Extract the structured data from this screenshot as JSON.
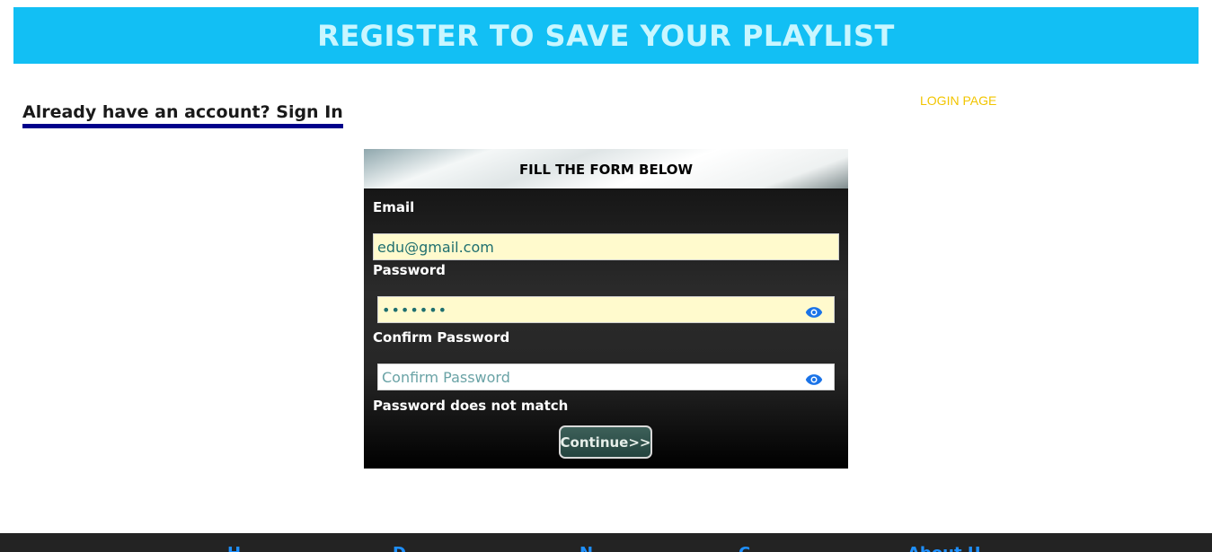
{
  "header": {
    "title": "REGISTER TO SAVE YOUR PLAYLIST"
  },
  "signin_prompt": "Already have an account? Sign In",
  "login_page_link": "LOGIN PAGE",
  "form": {
    "title": "FILL THE FORM BELOW",
    "email_label": "Email",
    "email_value": "edu@gmail.com",
    "password_label": "Password",
    "password_value": "•••••••",
    "confirm_label": "Confirm Password",
    "confirm_placeholder": "Confirm Password",
    "error_message": "Password does not match",
    "continue_label": "Continue>>"
  },
  "footer": {
    "nav_items": [
      "H",
      "D",
      "N",
      "C",
      "About U"
    ]
  },
  "icons": {
    "password_toggle": "eye-icon",
    "confirm_toggle": "eye-icon"
  },
  "colors": {
    "banner": "#12bff4",
    "banner_text": "#c9f6ff",
    "login_link": "#f2c500",
    "input_bg": "#fffacd",
    "eye_icon": "#1a73e8",
    "footer_bg": "#232323"
  }
}
